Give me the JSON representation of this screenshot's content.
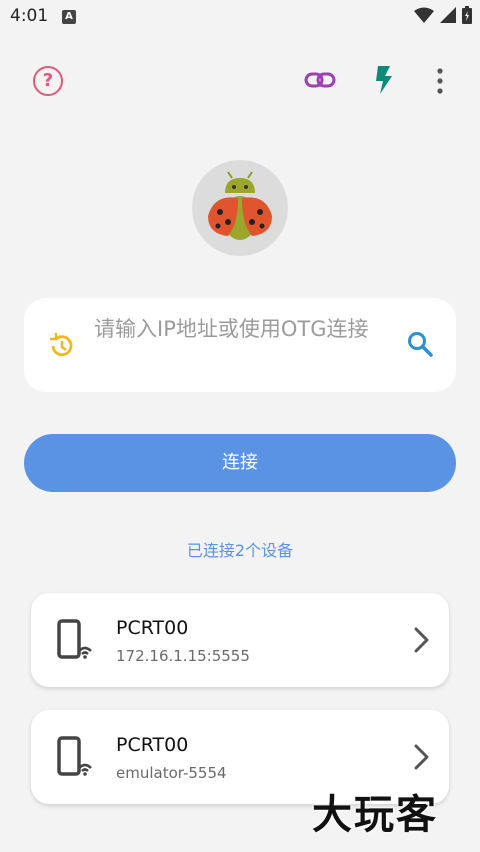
{
  "status_bar": {
    "time": "4:01",
    "notification_letter": "A",
    "icons": [
      "wifi-icon",
      "signal-icon",
      "battery-icon"
    ]
  },
  "toolbar": {
    "icons": [
      "help-icon",
      "link-icon",
      "flash-icon",
      "more-vert-icon"
    ],
    "colors": {
      "help": "#e0577f",
      "link": "#9c3fb3",
      "flash": "#0b8a78",
      "more": "#555555"
    }
  },
  "search": {
    "placeholder": "请输入IP地址或使用OTG连接",
    "history_icon": "history-icon",
    "search_icon": "search-icon",
    "history_color": "#f0b81c",
    "search_color": "#2a8fd8"
  },
  "connect_button": {
    "label": "连接",
    "color": "#5b93e4"
  },
  "connected_text": "已连接2个设备",
  "devices": [
    {
      "name": "PCRT00",
      "address": "172.16.1.15:5555"
    },
    {
      "name": "PCRT00",
      "address": "emulator-5554"
    }
  ],
  "watermark": "大玩客"
}
